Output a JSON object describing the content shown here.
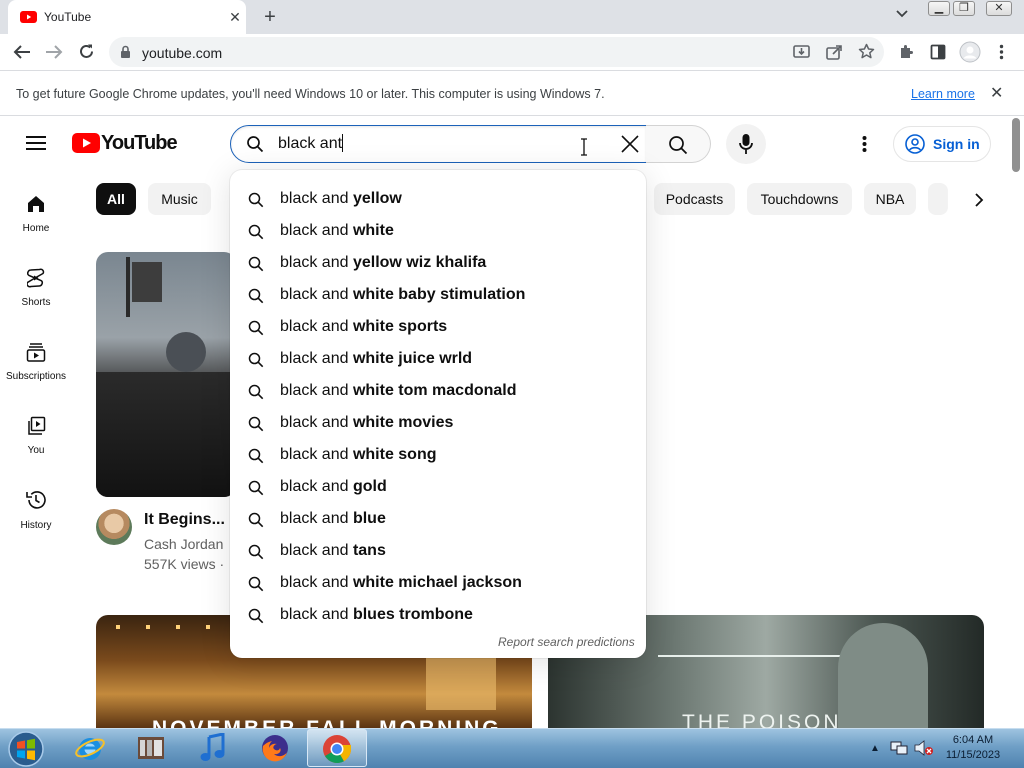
{
  "browser": {
    "tab_title": "YouTube",
    "url": "youtube.com",
    "infobar_text": "To get future Google Chrome updates, you'll need Windows 10 or later. This computer is using Windows 7.",
    "learn_more": "Learn more"
  },
  "youtube": {
    "logo_text": "YouTube",
    "search_value": "black ant",
    "signin_label": "Sign in",
    "chips": [
      "All",
      "Music",
      "Podcasts",
      "Touchdowns",
      "NBA"
    ],
    "sidebar": [
      {
        "label": "Home",
        "icon": "home-icon"
      },
      {
        "label": "Shorts",
        "icon": "shorts-icon"
      },
      {
        "label": "Subscriptions",
        "icon": "subscriptions-icon"
      },
      {
        "label": "You",
        "icon": "you-icon"
      },
      {
        "label": "History",
        "icon": "history-icon"
      }
    ],
    "video1": {
      "title": "It Begins... N",
      "channel": "Cash Jordan",
      "views": "557K views ·"
    },
    "thumb_bottom_left_text": "NOVEMBER FALL MORNING",
    "thumb_bottom_right_text": "THE POISON",
    "suggestions": [
      {
        "prefix": "black and",
        "bold": " yellow"
      },
      {
        "prefix": "black and",
        "bold": " white"
      },
      {
        "prefix": "black and",
        "bold": " yellow wiz khalifa"
      },
      {
        "prefix": "black and",
        "bold": " white baby stimulation"
      },
      {
        "prefix": "black and",
        "bold": " white sports"
      },
      {
        "prefix": "black and",
        "bold": " white juice wrld"
      },
      {
        "prefix": "black and",
        "bold": " white tom macdonald"
      },
      {
        "prefix": "black and",
        "bold": " white movies"
      },
      {
        "prefix": "black and",
        "bold": " white song"
      },
      {
        "prefix": "black and",
        "bold": " gold"
      },
      {
        "prefix": "black and",
        "bold": " blue"
      },
      {
        "prefix": "black and",
        "bold": " tans"
      },
      {
        "prefix": "black and",
        "bold": " white michael jackson"
      },
      {
        "prefix": "black and",
        "bold": " blues trombone"
      }
    ],
    "report_label": "Report search predictions"
  },
  "taskbar": {
    "time": "6:04 AM",
    "date": "11/15/2023"
  }
}
